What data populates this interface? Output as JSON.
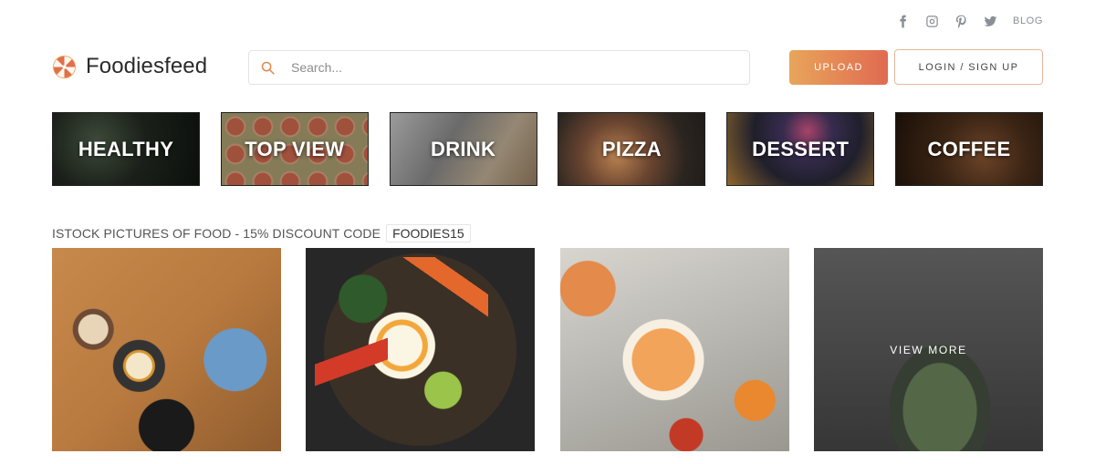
{
  "social": {
    "icons": [
      "facebook-icon",
      "instagram-icon",
      "pinterest-icon",
      "twitter-icon"
    ],
    "blog_label": "BLOG"
  },
  "header": {
    "logo_text": "Foodiesfeed",
    "search_placeholder": "Search...",
    "upload_label": "UPLOAD",
    "login_label": "LOGIN / SIGN UP"
  },
  "categories": [
    {
      "label": "HEALTHY"
    },
    {
      "label": "TOP VIEW"
    },
    {
      "label": "DRINK"
    },
    {
      "label": "PIZZA"
    },
    {
      "label": "DESSERT"
    },
    {
      "label": "COFFEE"
    }
  ],
  "promo": {
    "text": "ISTOCK PICTURES OF FOOD - 15% DISCOUNT CODE",
    "code": "FOODIES15"
  },
  "photos": {
    "view_more_label": "VIEW MORE"
  },
  "colors": {
    "accent_gradient_start": "#e8a55a",
    "accent_gradient_end": "#e06a52",
    "login_border": "#e7b79a",
    "icon_gray": "#8a8f95"
  }
}
